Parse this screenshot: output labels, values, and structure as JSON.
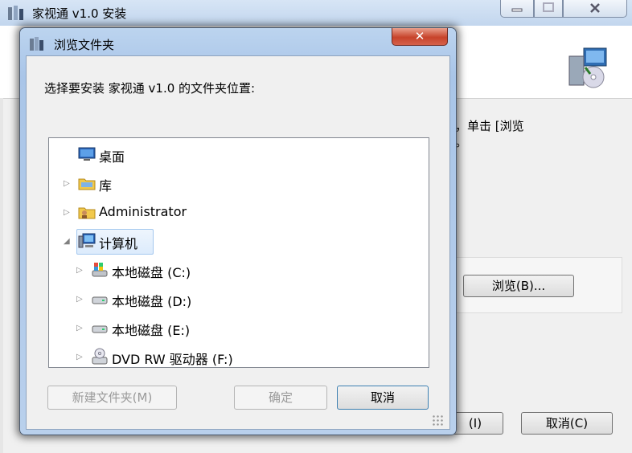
{
  "background_window": {
    "title": "家视通 v1.0 安装",
    "instruction_fragment_line1": "，单击 [浏览",
    "instruction_fragment_line2": "。",
    "browse_button_label": "浏览(B)...",
    "next_button_label": "(I)",
    "cancel_button_label": "取消(C)"
  },
  "dialog": {
    "title": "浏览文件夹",
    "prompt": "选择要安装 家视通 v1.0 的文件夹位置:",
    "tree": [
      {
        "label": "桌面",
        "icon": "desktop-icon",
        "expander": "",
        "level": 0,
        "selected": false
      },
      {
        "label": "库",
        "icon": "library-folder-icon",
        "expander": "▷",
        "level": 0,
        "selected": false
      },
      {
        "label": "Administrator",
        "icon": "user-folder-icon",
        "expander": "▷",
        "level": 0,
        "selected": false
      },
      {
        "label": "计算机",
        "icon": "computer-icon",
        "expander": "◢",
        "level": 0,
        "selected": true
      },
      {
        "label": "本地磁盘 (C:)",
        "icon": "system-drive-icon",
        "expander": "▷",
        "level": 1,
        "selected": false
      },
      {
        "label": "本地磁盘 (D:)",
        "icon": "hard-drive-icon",
        "expander": "▷",
        "level": 1,
        "selected": false
      },
      {
        "label": "本地磁盘 (E:)",
        "icon": "hard-drive-icon",
        "expander": "▷",
        "level": 1,
        "selected": false
      },
      {
        "label": "DVD RW 驱动器 (F:)",
        "icon": "dvd-drive-icon",
        "expander": "▷",
        "level": 1,
        "selected": false
      }
    ],
    "buttons": {
      "new_folder": "新建文件夹(M)",
      "ok": "确定",
      "cancel": "取消"
    },
    "close_glyph": "✕"
  },
  "colors": {
    "selection": "#dcebfc",
    "titlebar": "#c2d6ee",
    "close_button": "#c7432b"
  }
}
